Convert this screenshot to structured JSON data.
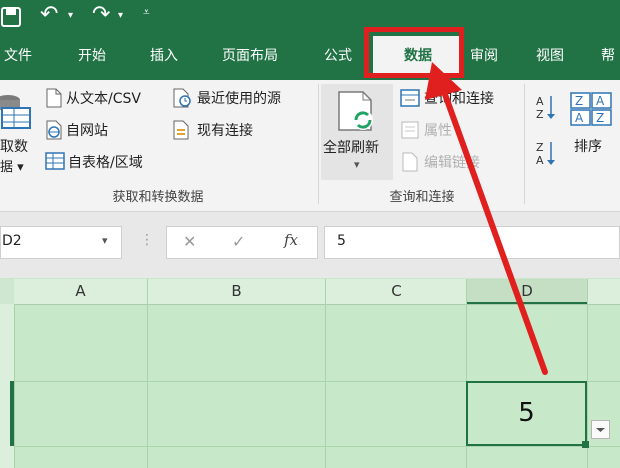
{
  "qat": {
    "undo": "↶",
    "redo": "↷",
    "customize": "⩡"
  },
  "tabs": [
    {
      "label": "文件"
    },
    {
      "label": "开始"
    },
    {
      "label": "插入"
    },
    {
      "label": "页面布局"
    },
    {
      "label": "公式"
    },
    {
      "label": "数据"
    },
    {
      "label": "审阅"
    },
    {
      "label": "视图"
    },
    {
      "label": "帮"
    }
  ],
  "ribbon": {
    "get_data": {
      "line1": "取数",
      "line2": "据 ▾"
    },
    "from_text_csv": "从文本/CSV",
    "recent_sources": "最近使用的源",
    "from_web": "自网站",
    "existing_connections": "现有连接",
    "from_table": "自表格/区域",
    "group1_label": "获取和转换数据",
    "refresh_all": "全部刷新",
    "refresh_arrow": "▾",
    "queries_connections": "查询和连接",
    "properties": "属性",
    "edit_links": "编辑链接",
    "group2_label": "查询和连接",
    "sort": "排序"
  },
  "formula_bar": {
    "name_box": "D2",
    "cancel": "✕",
    "enter": "✓",
    "fx": "fx",
    "value": "5"
  },
  "grid": {
    "columns": [
      "A",
      "B",
      "C",
      "D"
    ],
    "active_cell_value": "5"
  },
  "colors": {
    "excel_green": "#217346",
    "highlight_red": "#e0201f",
    "sheet_tint": "#c8e9c9"
  }
}
